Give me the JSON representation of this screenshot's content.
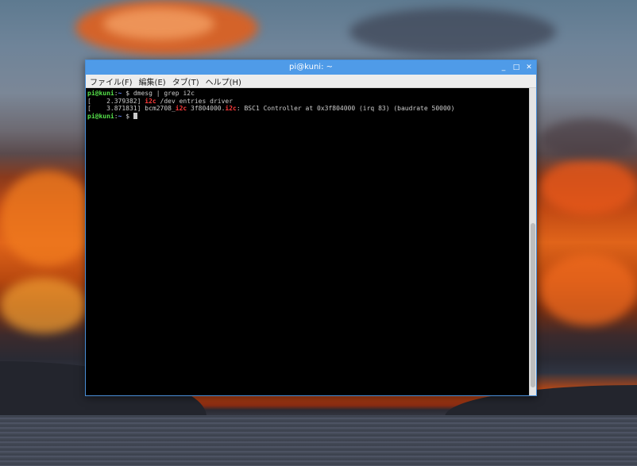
{
  "window": {
    "title": "pi@kuni: ~",
    "minimize_glyph": "_",
    "maximize_glyph": "□",
    "close_glyph": "✕"
  },
  "menu": {
    "items": [
      {
        "label": "ファイル(F)"
      },
      {
        "label": "編集(E)"
      },
      {
        "label": "タブ(T)"
      },
      {
        "label": "ヘルプ(H)"
      }
    ]
  },
  "terminal": {
    "line1": {
      "user": "pi@kuni",
      "sep": ":",
      "path": "~",
      "dollar": " $ ",
      "command": "dmesg | grep i2c"
    },
    "line2": {
      "prefix": "[    2.379382] ",
      "hl": "i2c",
      "rest": " /dev entries driver"
    },
    "line3": {
      "prefix": "[    3.871831] bcm2708_",
      "hl1": "i2c",
      "mid": " 3f804000.",
      "hl2": "i2c",
      "rest": ": BSC1 Controller at 0x3f804000 (irq 83) (baudrate 50000)"
    },
    "line4": {
      "user": "pi@kuni",
      "sep": ":",
      "path": "~",
      "dollar": " $ "
    }
  },
  "colors": {
    "titlebar": "#4f9be8",
    "terminal_bg": "#000000",
    "prompt_user": "#55e04a",
    "prompt_path": "#6a8cff",
    "highlight": "#ff3b3b"
  }
}
